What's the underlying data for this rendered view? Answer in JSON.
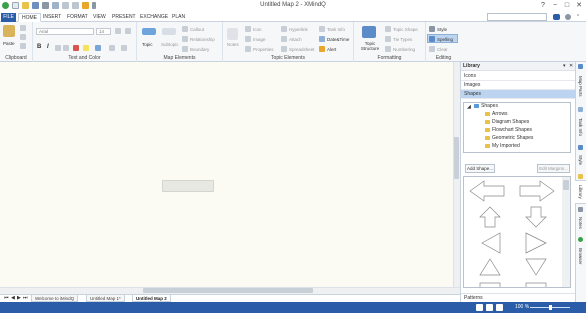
{
  "window": {
    "title": "Untitled Map 2 - XMindQ",
    "minimize": "−",
    "maximize": "□",
    "close": "✕"
  },
  "ribbon_tabs": [
    "FILE",
    "HOME",
    "INSERT",
    "FORMAT",
    "VIEW",
    "PRESENT",
    "EXCHANGE",
    "PLAN"
  ],
  "ribbon": {
    "clipboard": {
      "paste": "Paste",
      "label": "Clipboard"
    },
    "text_color": {
      "font": "Arial",
      "size": "14",
      "bold": "B",
      "italic": "I",
      "label": "Text and Color"
    },
    "map_elements": {
      "topic": "Topic",
      "subtopic": "Subtopic",
      "callout": "Callout",
      "relationship": "Relationship",
      "boundary": "Boundary",
      "label": "Map Elements"
    },
    "topic_elements": {
      "notes": "Notes",
      "icon": "Icon",
      "image": "Image",
      "properties": "Properties",
      "hyperlink": "Hyperlink",
      "attach": "Attach",
      "spreadsheet": "Spreadsheet",
      "task_info": "Task Info",
      "date_time": "Date&Time",
      "alert": "Alert",
      "label": "Topic Elements"
    },
    "formatting": {
      "structure": "Topic Structure",
      "topic_shape": "Topic Shape",
      "tie_types": "Tie Types",
      "numbering": "Numbering",
      "label": "Formatting"
    },
    "editing": {
      "style": "Style",
      "spelling": "Spelling",
      "clear": "Clear",
      "label": "Editing"
    }
  },
  "library": {
    "title": "Library",
    "categories": [
      "Icons",
      "Images",
      "Shapes"
    ],
    "selected_category": "Shapes",
    "tree_root": "Shapes",
    "tree_items": [
      "Arrows",
      "Diagram Shapes",
      "Flowchart Shapes",
      "Geometric Shapes",
      "My Imported"
    ],
    "add_shape": "Add Shape...",
    "edit_margins": "Edit Margins...",
    "patterns": "Patterns"
  },
  "side_tabs": [
    "Map Parts",
    "Task Info",
    "Style",
    "Library",
    "Notes",
    "Browser"
  ],
  "active_side_tab": "Library",
  "sheets": [
    "Welcome to iMindQ",
    "Untitled Map 1*",
    "Untitled Map 2"
  ],
  "active_sheet": "Untitled Map 2",
  "status": {
    "zoom": "100 %"
  },
  "colors": {
    "accent": "#2a5ca8",
    "canvas": "#fbfbf3",
    "selected": "#bcd4f0"
  }
}
